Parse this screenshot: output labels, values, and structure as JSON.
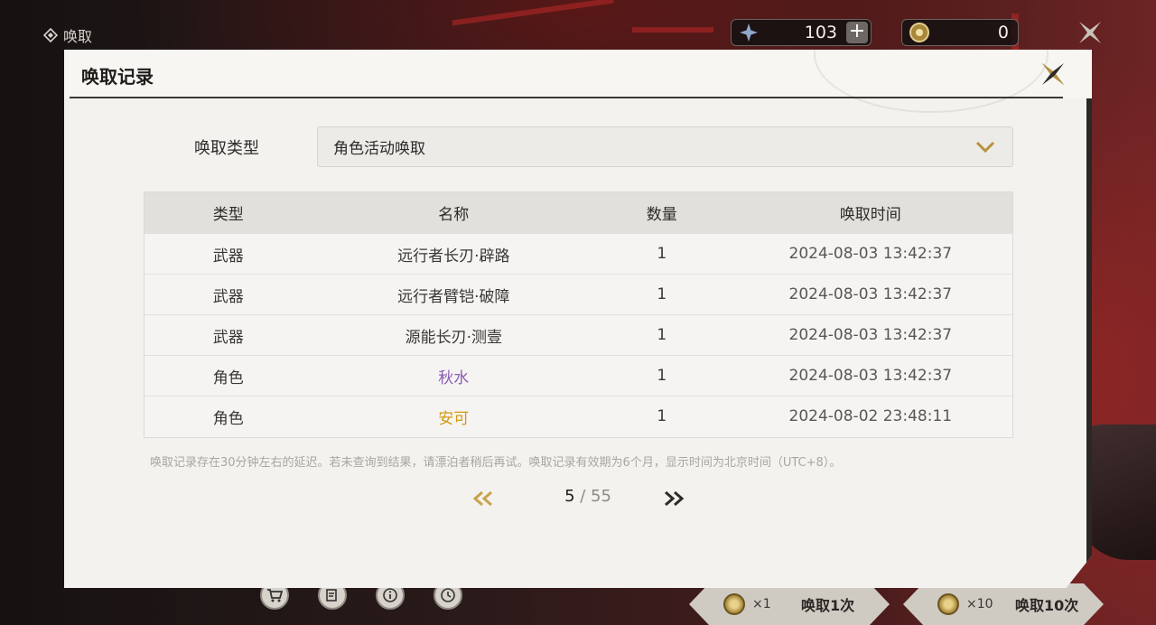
{
  "topbar": {
    "title": "唤取",
    "star_currency": "103",
    "coin_currency": "0",
    "plus_label": "+"
  },
  "modal": {
    "title": "唤取记录",
    "filter_label": "唤取类型",
    "filter_value": "角色活动唤取",
    "columns": [
      "类型",
      "名称",
      "数量",
      "唤取时间"
    ],
    "rows": [
      {
        "type": "武器",
        "name": "远行者长刃·辟路",
        "qty": "1",
        "time": "2024-08-03 13:42:37",
        "quality": "normal"
      },
      {
        "type": "武器",
        "name": "远行者臂铠·破障",
        "qty": "1",
        "time": "2024-08-03 13:42:37",
        "quality": "normal"
      },
      {
        "type": "武器",
        "name": "源能长刃·测壹",
        "qty": "1",
        "time": "2024-08-03 13:42:37",
        "quality": "normal"
      },
      {
        "type": "角色",
        "name": "秋水",
        "qty": "1",
        "time": "2024-08-03 13:42:37",
        "quality": "purple"
      },
      {
        "type": "角色",
        "name": "安可",
        "qty": "1",
        "time": "2024-08-02 23:48:11",
        "quality": "gold"
      }
    ],
    "notice": "唤取记录存在30分钟左右的延迟。若未查询到结果，请漂泊者稍后再试。唤取记录有效期为6个月，显示时间为北京时间（UTC+8）。",
    "pager": {
      "current": "5",
      "separator": " / ",
      "total": "55"
    }
  },
  "bottom": {
    "pull_one_count": "×1",
    "pull_one_label": "唤取1次",
    "pull_ten_count": "×10",
    "pull_ten_label": "唤取10次"
  },
  "colors": {
    "quality_purple": "#8a5bb3",
    "quality_gold": "#d49a10",
    "accent_gold": "#c9a24a"
  }
}
